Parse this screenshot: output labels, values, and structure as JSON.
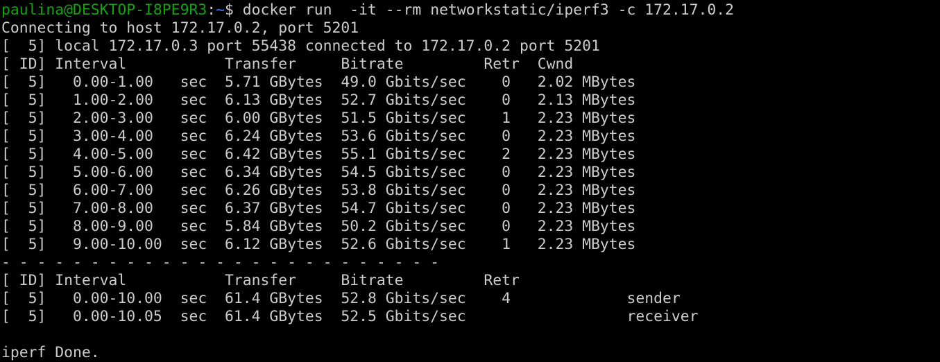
{
  "colors": {
    "background": "#000000",
    "text": "#cccccc",
    "prompt_user": "#13a10e",
    "prompt_path": "#3b78ff"
  },
  "prompt": {
    "user_host": "paulina@DESKTOP-I8PE9R3",
    "separator": ":",
    "path": "~",
    "symbol": "$ ",
    "command": "docker run  -it --rm networkstatic/iperf3 -c 172.17.0.2"
  },
  "output": {
    "connecting": "Connecting to host 172.17.0.2, port 5201",
    "local": "[  5] local 172.17.0.3 port 55438 connected to 172.17.0.2 port 5201",
    "header": "[ ID] Interval           Transfer     Bitrate         Retr  Cwnd",
    "rows": [
      "[  5]   0.00-1.00   sec  5.71 GBytes  49.0 Gbits/sec    0   2.02 MBytes",
      "[  5]   1.00-2.00   sec  6.13 GBytes  52.7 Gbits/sec    0   2.13 MBytes",
      "[  5]   2.00-3.00   sec  6.00 GBytes  51.5 Gbits/sec    1   2.23 MBytes",
      "[  5]   3.00-4.00   sec  6.24 GBytes  53.6 Gbits/sec    0   2.23 MBytes",
      "[  5]   4.00-5.00   sec  6.42 GBytes  55.1 Gbits/sec    2   2.23 MBytes",
      "[  5]   5.00-6.00   sec  6.34 GBytes  54.5 Gbits/sec    0   2.23 MBytes",
      "[  5]   6.00-7.00   sec  6.26 GBytes  53.8 Gbits/sec    0   2.23 MBytes",
      "[  5]   7.00-8.00   sec  6.37 GBytes  54.7 Gbits/sec    0   2.23 MBytes",
      "[  5]   8.00-9.00   sec  5.84 GBytes  50.2 Gbits/sec    0   2.23 MBytes",
      "[  5]   9.00-10.00  sec  6.12 GBytes  52.6 Gbits/sec    1   2.23 MBytes"
    ],
    "divider": "- - - - - - - - - - - - - - - - - - - - - - - - -",
    "summary_header": "[ ID] Interval           Transfer     Bitrate         Retr",
    "summary_rows": [
      "[  5]   0.00-10.00  sec  61.4 GBytes  52.8 Gbits/sec    4             sender",
      "[  5]   0.00-10.05  sec  61.4 GBytes  52.5 Gbits/sec                  receiver"
    ],
    "blank": "",
    "done": "iperf Done."
  }
}
